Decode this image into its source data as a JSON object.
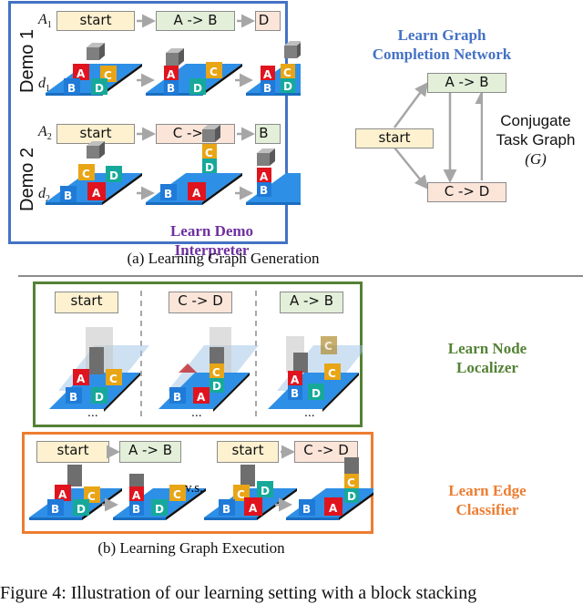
{
  "figure": {
    "part_a": {
      "caption": "(a) Learning Graph Generation",
      "demo_box_label": "Learn Demo Interpreter",
      "demo_box_color": "#4472c4",
      "demos": [
        {
          "label": "Demo 1",
          "action_var": "A",
          "action_sub": "1",
          "demo_var": "d",
          "demo_sub": "1",
          "sequence": [
            "start",
            "A -> B",
            "C -> D"
          ]
        },
        {
          "label": "Demo 2",
          "action_var": "A",
          "action_sub": "2",
          "demo_var": "d",
          "demo_sub": "2",
          "sequence": [
            "start",
            "C -> D",
            "A -> B"
          ]
        }
      ],
      "graph": {
        "title_line1": "Learn Graph",
        "title_line2": "Completion Network",
        "title_color": "#4472c4",
        "nodes": {
          "start": "start",
          "ab": "A -> B",
          "cd": "C -> D"
        },
        "label_line1": "Conjugate",
        "label_line2": "Task Graph",
        "label_line3": "(G)"
      }
    },
    "part_b": {
      "caption": "(b) Learning Graph Execution",
      "localizer": {
        "label_line1": "Learn Node",
        "label_line2": "Localizer",
        "color": "#548235",
        "panels": [
          "start",
          "C -> D",
          "A -> B"
        ],
        "ellipsis": "..."
      },
      "edge_classifier": {
        "label_line1": "Learn Edge",
        "label_line2": "Classifier",
        "color": "#ed7d31",
        "left_pair": [
          "start",
          "A -> B"
        ],
        "right_pair": [
          "start",
          "C -> D"
        ],
        "versus": "v.s."
      }
    },
    "figure_caption": "Figure 4: Illustration of our learning setting with a block stacking"
  },
  "colors": {
    "start_fill": "#fdf1cf",
    "ab_fill": "#e3efd9",
    "cd_fill": "#fbe5d9",
    "block_a": "#e0141e",
    "block_b": "#1f7ad8",
    "block_c": "#e8a516",
    "block_d": "#16a99a",
    "table": "#2e8fe6",
    "interpreter_label": "#7030a0"
  }
}
